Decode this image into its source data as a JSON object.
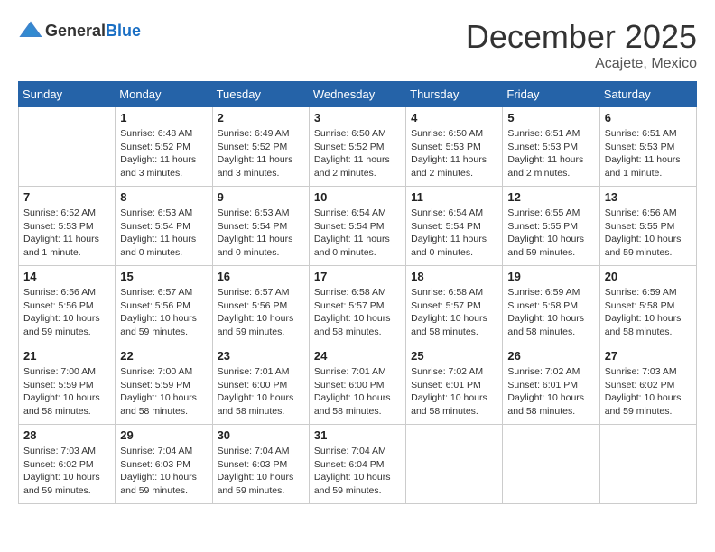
{
  "header": {
    "logo_general": "General",
    "logo_blue": "Blue",
    "month_title": "December 2025",
    "location": "Acajete, Mexico"
  },
  "weekdays": [
    "Sunday",
    "Monday",
    "Tuesday",
    "Wednesday",
    "Thursday",
    "Friday",
    "Saturday"
  ],
  "weeks": [
    [
      {
        "day": "",
        "info": ""
      },
      {
        "day": "1",
        "info": "Sunrise: 6:48 AM\nSunset: 5:52 PM\nDaylight: 11 hours and 3 minutes."
      },
      {
        "day": "2",
        "info": "Sunrise: 6:49 AM\nSunset: 5:52 PM\nDaylight: 11 hours and 3 minutes."
      },
      {
        "day": "3",
        "info": "Sunrise: 6:50 AM\nSunset: 5:52 PM\nDaylight: 11 hours and 2 minutes."
      },
      {
        "day": "4",
        "info": "Sunrise: 6:50 AM\nSunset: 5:53 PM\nDaylight: 11 hours and 2 minutes."
      },
      {
        "day": "5",
        "info": "Sunrise: 6:51 AM\nSunset: 5:53 PM\nDaylight: 11 hours and 2 minutes."
      },
      {
        "day": "6",
        "info": "Sunrise: 6:51 AM\nSunset: 5:53 PM\nDaylight: 11 hours and 1 minute."
      }
    ],
    [
      {
        "day": "7",
        "info": "Sunrise: 6:52 AM\nSunset: 5:53 PM\nDaylight: 11 hours and 1 minute."
      },
      {
        "day": "8",
        "info": "Sunrise: 6:53 AM\nSunset: 5:54 PM\nDaylight: 11 hours and 0 minutes."
      },
      {
        "day": "9",
        "info": "Sunrise: 6:53 AM\nSunset: 5:54 PM\nDaylight: 11 hours and 0 minutes."
      },
      {
        "day": "10",
        "info": "Sunrise: 6:54 AM\nSunset: 5:54 PM\nDaylight: 11 hours and 0 minutes."
      },
      {
        "day": "11",
        "info": "Sunrise: 6:54 AM\nSunset: 5:54 PM\nDaylight: 11 hours and 0 minutes."
      },
      {
        "day": "12",
        "info": "Sunrise: 6:55 AM\nSunset: 5:55 PM\nDaylight: 10 hours and 59 minutes."
      },
      {
        "day": "13",
        "info": "Sunrise: 6:56 AM\nSunset: 5:55 PM\nDaylight: 10 hours and 59 minutes."
      }
    ],
    [
      {
        "day": "14",
        "info": "Sunrise: 6:56 AM\nSunset: 5:56 PM\nDaylight: 10 hours and 59 minutes."
      },
      {
        "day": "15",
        "info": "Sunrise: 6:57 AM\nSunset: 5:56 PM\nDaylight: 10 hours and 59 minutes."
      },
      {
        "day": "16",
        "info": "Sunrise: 6:57 AM\nSunset: 5:56 PM\nDaylight: 10 hours and 59 minutes."
      },
      {
        "day": "17",
        "info": "Sunrise: 6:58 AM\nSunset: 5:57 PM\nDaylight: 10 hours and 58 minutes."
      },
      {
        "day": "18",
        "info": "Sunrise: 6:58 AM\nSunset: 5:57 PM\nDaylight: 10 hours and 58 minutes."
      },
      {
        "day": "19",
        "info": "Sunrise: 6:59 AM\nSunset: 5:58 PM\nDaylight: 10 hours and 58 minutes."
      },
      {
        "day": "20",
        "info": "Sunrise: 6:59 AM\nSunset: 5:58 PM\nDaylight: 10 hours and 58 minutes."
      }
    ],
    [
      {
        "day": "21",
        "info": "Sunrise: 7:00 AM\nSunset: 5:59 PM\nDaylight: 10 hours and 58 minutes."
      },
      {
        "day": "22",
        "info": "Sunrise: 7:00 AM\nSunset: 5:59 PM\nDaylight: 10 hours and 58 minutes."
      },
      {
        "day": "23",
        "info": "Sunrise: 7:01 AM\nSunset: 6:00 PM\nDaylight: 10 hours and 58 minutes."
      },
      {
        "day": "24",
        "info": "Sunrise: 7:01 AM\nSunset: 6:00 PM\nDaylight: 10 hours and 58 minutes."
      },
      {
        "day": "25",
        "info": "Sunrise: 7:02 AM\nSunset: 6:01 PM\nDaylight: 10 hours and 58 minutes."
      },
      {
        "day": "26",
        "info": "Sunrise: 7:02 AM\nSunset: 6:01 PM\nDaylight: 10 hours and 58 minutes."
      },
      {
        "day": "27",
        "info": "Sunrise: 7:03 AM\nSunset: 6:02 PM\nDaylight: 10 hours and 59 minutes."
      }
    ],
    [
      {
        "day": "28",
        "info": "Sunrise: 7:03 AM\nSunset: 6:02 PM\nDaylight: 10 hours and 59 minutes."
      },
      {
        "day": "29",
        "info": "Sunrise: 7:04 AM\nSunset: 6:03 PM\nDaylight: 10 hours and 59 minutes."
      },
      {
        "day": "30",
        "info": "Sunrise: 7:04 AM\nSunset: 6:03 PM\nDaylight: 10 hours and 59 minutes."
      },
      {
        "day": "31",
        "info": "Sunrise: 7:04 AM\nSunset: 6:04 PM\nDaylight: 10 hours and 59 minutes."
      },
      {
        "day": "",
        "info": ""
      },
      {
        "day": "",
        "info": ""
      },
      {
        "day": "",
        "info": ""
      }
    ]
  ]
}
